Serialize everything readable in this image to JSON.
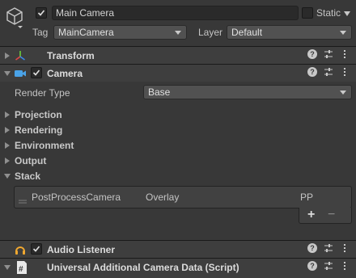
{
  "gameobject": {
    "name": "Main Camera",
    "static_label": "Static",
    "tag_label": "Tag",
    "tag_value": "MainCamera",
    "layer_label": "Layer",
    "layer_value": "Default",
    "active": true,
    "static": false
  },
  "components": {
    "transform": {
      "title": "Transform",
      "icon": "transform-icon"
    },
    "camera": {
      "title": "Camera",
      "icon": "camera-icon",
      "enabled": true,
      "render_type_label": "Render Type",
      "render_type_value": "Base",
      "sections": [
        "Projection",
        "Rendering",
        "Environment",
        "Output",
        "Stack"
      ],
      "stack": {
        "items": [
          {
            "name": "PostProcessCamera",
            "type": "Overlay",
            "tag": "PP"
          }
        ],
        "add_label": "+",
        "remove_label": "−"
      }
    },
    "audio_listener": {
      "title": "Audio Listener",
      "icon": "headphones-icon",
      "enabled": true
    },
    "additional_camera_data": {
      "title": "Universal Additional Camera Data (Script)",
      "icon": "csharp-script-icon"
    }
  },
  "colors": {
    "background": "#383838",
    "header": "#3e3e3e",
    "field": "#2a2a2a",
    "camera_icon": "#4aa3e8",
    "headphones_icon": "#f0a830"
  }
}
